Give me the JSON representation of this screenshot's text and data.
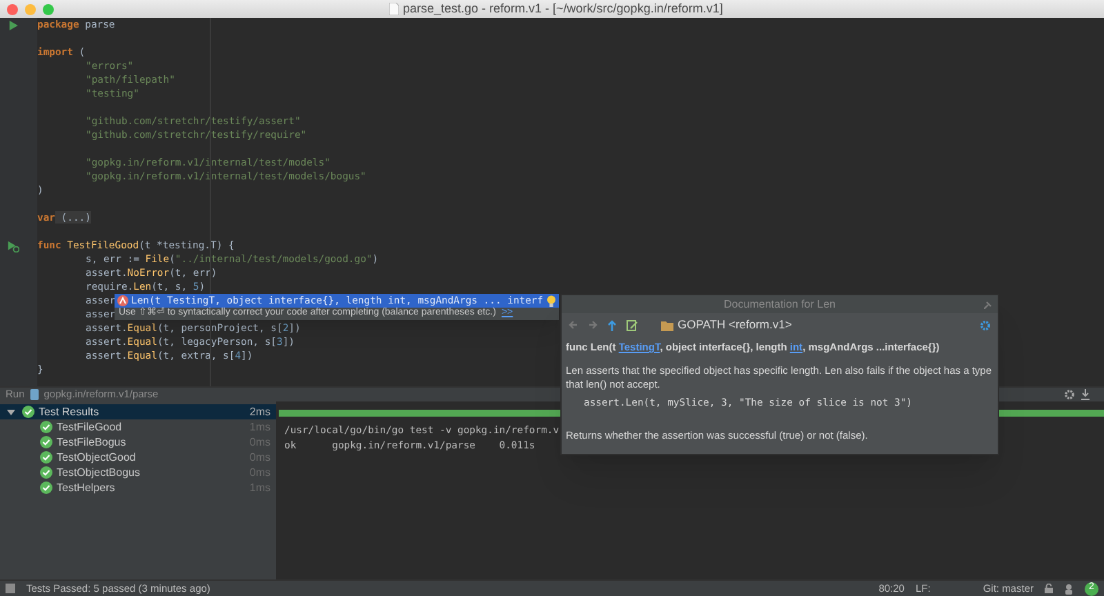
{
  "window": {
    "title": "parse_test.go - reform.v1 - [~/work/src/gopkg.in/reform.v1]"
  },
  "editor": {
    "blocks": [
      [
        {
          "kind": "run",
          "indented": false,
          "tokens": [
            {
              "text": "package",
              "kind": "keyword"
            },
            {
              "text": " parse",
              "kind": "plain"
            }
          ]
        }
      ],
      [
        {
          "kind": "code",
          "indented": false,
          "tokens": [
            {
              "text": "import",
              "kind": "keyword"
            },
            {
              "text": " (",
              "kind": "plain"
            }
          ]
        },
        {
          "kind": "code",
          "indented": true,
          "tokens": [
            {
              "text": "\"errors\"",
              "kind": "string"
            }
          ]
        },
        {
          "kind": "code",
          "indented": true,
          "tokens": [
            {
              "text": "\"path/filepath\"",
              "kind": "string"
            }
          ]
        },
        {
          "kind": "code",
          "indented": true,
          "tokens": [
            {
              "text": "\"testing\"",
              "kind": "string"
            }
          ]
        }
      ],
      [
        {
          "kind": "code",
          "indented": true,
          "tokens": [
            {
              "text": "\"github.com/stretchr/testify/assert\"",
              "kind": "string"
            }
          ]
        },
        {
          "kind": "code",
          "indented": true,
          "tokens": [
            {
              "text": "\"github.com/stretchr/testify/require\"",
              "kind": "string"
            }
          ]
        }
      ],
      [
        {
          "kind": "code",
          "indented": true,
          "tokens": [
            {
              "text": "\"gopkg.in/reform.v1/internal/test/models\"",
              "kind": "string"
            }
          ]
        },
        {
          "kind": "code",
          "indented": true,
          "tokens": [
            {
              "text": "\"gopkg.in/reform.v1/internal/test/models/bogus\"",
              "kind": "string"
            }
          ]
        },
        {
          "kind": "code",
          "indented": false,
          "tokens": [
            {
              "text": ")",
              "kind": "plain"
            }
          ]
        }
      ],
      [
        {
          "kind": "code",
          "indented": false,
          "tokens": [
            {
              "text": "var",
              "kind": "keyword"
            },
            {
              "text": " (...)",
              "kind": "folded"
            }
          ]
        }
      ],
      [
        {
          "kind": "run-test",
          "indented": false,
          "tokens": [
            {
              "text": "func",
              "kind": "keyword"
            },
            {
              "text": " TestFileGood",
              "kind": "function"
            },
            {
              "text": "(t *testing.T) {",
              "kind": "plain"
            }
          ]
        },
        {
          "kind": "code",
          "indented": true,
          "tokens": [
            {
              "text": "s, err := ",
              "kind": "plain"
            },
            {
              "text": "File",
              "kind": "function"
            },
            {
              "text": "(",
              "kind": "plain"
            },
            {
              "text": "\"../internal/test/models/good.go\"",
              "kind": "string"
            },
            {
              "text": ")",
              "kind": "plain"
            }
          ]
        },
        {
          "kind": "code",
          "indented": true,
          "tokens": [
            {
              "text": "assert.",
              "kind": "plain"
            },
            {
              "text": "NoError",
              "kind": "function"
            },
            {
              "text": "(t, err)",
              "kind": "plain"
            }
          ]
        },
        {
          "kind": "code",
          "indented": true,
          "tokens": [
            {
              "text": "require.",
              "kind": "plain"
            },
            {
              "text": "Len",
              "kind": "function"
            },
            {
              "text": "(t, s, ",
              "kind": "plain"
            },
            {
              "text": "5",
              "kind": "number"
            },
            {
              "text": ")",
              "kind": "plain"
            }
          ]
        },
        {
          "kind": "code",
          "indented": true,
          "tokens": [
            {
              "text": "asser",
              "kind": "plain"
            }
          ]
        },
        {
          "kind": "code",
          "indented": true,
          "tokens": [
            {
              "text": "asser",
              "kind": "plain"
            }
          ]
        },
        {
          "kind": "code",
          "indented": true,
          "tokens": [
            {
              "text": "assert.",
              "kind": "plain"
            },
            {
              "text": "Equal",
              "kind": "function"
            },
            {
              "text": "(t, personProject, s[",
              "kind": "plain"
            },
            {
              "text": "2",
              "kind": "number"
            },
            {
              "text": "])",
              "kind": "plain"
            }
          ]
        },
        {
          "kind": "code",
          "indented": true,
          "tokens": [
            {
              "text": "assert.",
              "kind": "plain"
            },
            {
              "text": "Equal",
              "kind": "function"
            },
            {
              "text": "(t, legacyPerson, s[",
              "kind": "plain"
            },
            {
              "text": "3",
              "kind": "number"
            },
            {
              "text": "])",
              "kind": "plain"
            }
          ]
        },
        {
          "kind": "code",
          "indented": true,
          "tokens": [
            {
              "text": "assert.",
              "kind": "plain"
            },
            {
              "text": "Equal",
              "kind": "function"
            },
            {
              "text": "(t, extra, s[",
              "kind": "plain"
            },
            {
              "text": "4",
              "kind": "number"
            },
            {
              "text": "])",
              "kind": "plain"
            }
          ]
        },
        {
          "kind": "code",
          "indented": false,
          "tokens": [
            {
              "text": "}",
              "kind": "plain"
            }
          ]
        }
      ]
    ]
  },
  "completion": {
    "suggestion": "Len(t TestingT, object interface{}, length int, msgAndArgs ... interf",
    "hint": "Use ⇧⌘⏎ to syntactically correct your code after completing (balance parentheses etc.)",
    "more_link": ">>"
  },
  "doc_popup": {
    "title": "Documentation for Len",
    "location": "GOPATH <reform.v1>",
    "signature": [
      {
        "text": "func Len(t ",
        "kind": "plain"
      },
      {
        "text": "TestingT",
        "kind": "link"
      },
      {
        "text": ", object interface{}, length ",
        "kind": "plain"
      },
      {
        "text": "int",
        "kind": "link"
      },
      {
        "text": ", msgAndArgs ...interface{})",
        "kind": "plain"
      }
    ],
    "description": "Len asserts that the specified object has specific length. Len also fails if the object has a type that len() not accept.",
    "example": "assert.Len(t, mySlice, 3, \"The size of slice is not 3\")",
    "returns": "Returns whether the assertion was successful (true) or not (false)."
  },
  "run_panel": {
    "label": "Run",
    "config": "gopkg.in/reform.v1/parse"
  },
  "test_tree": {
    "root": {
      "name": "Test Results",
      "time": "2ms",
      "expanded": true,
      "selected": true,
      "children": [
        {
          "name": "TestFileGood",
          "time": "1ms",
          "selected": false
        },
        {
          "name": "TestFileBogus",
          "time": "0ms",
          "selected": false
        },
        {
          "name": "TestObjectGood",
          "time": "0ms",
          "selected": false
        },
        {
          "name": "TestObjectBogus",
          "time": "0ms",
          "selected": false
        },
        {
          "name": "TestHelpers",
          "time": "1ms",
          "selected": false
        }
      ]
    }
  },
  "console": {
    "progress": {
      "level": 1
    },
    "lines": [
      "/usr/local/go/bin/go test -v gopkg.in/reform.v",
      "ok      gopkg.in/reform.v1/parse    0.011s"
    ]
  },
  "status_bar": {
    "message": "Tests Passed: 5 passed (3 minutes ago)",
    "position": "80:20",
    "line_separator": "LF:",
    "vcs": "Git: master",
    "notifications": "2"
  }
}
